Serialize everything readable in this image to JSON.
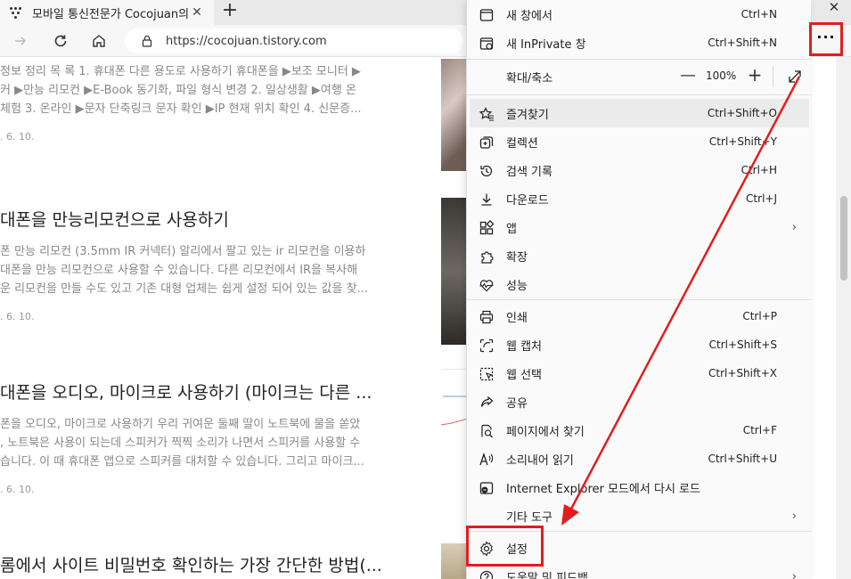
{
  "browser": {
    "tab_title": "모바일 통신전문가 Cocojuan의 :",
    "url": "https://cocojuan.tistory.com"
  },
  "articles": [
    {
      "title": "",
      "lines": [
        "정보 정리 목 록 1. 휴대폰 다른 용도로 사용하기 휴대폰을 ▶보조 모니터 ▶",
        "커 ▶만능 리모컨 ▶E-Book 동기화, 파일 형식 변경 2. 일상생활 ▶여행 온",
        " 체험 3. 온라인 ▶문자 단축링크 문자 확인 ▶IP 현재 위치 확인 4. 신문증..."
      ],
      "date": ". 6. 10."
    },
    {
      "title": "대폰을 만능리모컨으로 사용하기",
      "lines": [
        "폰 만능 리모컨 (3.5mm IR 커넥터) 알리에서 팔고 있는 ir 리모컨을 이용하",
        "대폰을 만능 리모컨으로 사용할 수 있습니다. 다른 리모컨에서 IR을 복사해",
        "운 리모컨을 만들 수도 있고 기존 대형 업체는 쉽게 설정 되어 있는 값을 찾..."
      ],
      "date": ". 6. 10."
    },
    {
      "title": "대폰을 오디오, 마이크로 사용하기 (마이크는 다른 ...",
      "lines": [
        "폰을 오디오, 마이크로 사용하기 우리 귀여운 둘째 딸이 노트북에 물을 쏟았",
        ", 노트북은 사용이 되는데 스피커가 찍찍 소리가 나면서 스피커를 사용할 수",
        "습니다. 이 때 휴대폰 앱으로 스피커를 대처할 수 있습니다. 그리고 마이크..."
      ],
      "date": ". 6. 10."
    },
    {
      "title": "롬에서 사이트 비밀번호 확인하는 가장 간단한 방법(...",
      "lines": [],
      "date": ""
    }
  ],
  "menu": {
    "items": [
      {
        "id": "new-window",
        "icon": "window-icon",
        "label": "새 창에서",
        "shortcut": "Ctrl+N"
      },
      {
        "id": "new-inprivate",
        "icon": "inprivate-icon",
        "label": "새 InPrivate 창",
        "shortcut": "Ctrl+Shift+N"
      },
      {
        "id": "zoom",
        "icon": "",
        "label": "확대/축소",
        "shortcut": ""
      },
      {
        "id": "favorites",
        "icon": "favorites-icon",
        "label": "즐겨찾기",
        "shortcut": "Ctrl+Shift+O"
      },
      {
        "id": "collections",
        "icon": "collections-icon",
        "label": "컬렉션",
        "shortcut": "Ctrl+Shift+Y"
      },
      {
        "id": "history",
        "icon": "history-icon",
        "label": "검색 기록",
        "shortcut": "Ctrl+H"
      },
      {
        "id": "downloads",
        "icon": "download-icon",
        "label": "다운로드",
        "shortcut": "Ctrl+J"
      },
      {
        "id": "apps",
        "icon": "apps-icon",
        "label": "앱",
        "shortcut": ""
      },
      {
        "id": "extensions",
        "icon": "extensions-icon",
        "label": "확장",
        "shortcut": ""
      },
      {
        "id": "performance",
        "icon": "performance-icon",
        "label": "성능",
        "shortcut": ""
      },
      {
        "id": "print",
        "icon": "print-icon",
        "label": "인쇄",
        "shortcut": "Ctrl+P"
      },
      {
        "id": "web-capture",
        "icon": "web-capture-icon",
        "label": "웹 캡처",
        "shortcut": "Ctrl+Shift+S"
      },
      {
        "id": "web-select",
        "icon": "web-select-icon",
        "label": "웹 선택",
        "shortcut": "Ctrl+Shift+X"
      },
      {
        "id": "share",
        "icon": "share-icon",
        "label": "공유",
        "shortcut": ""
      },
      {
        "id": "find",
        "icon": "find-icon",
        "label": "페이지에서 찾기",
        "shortcut": "Ctrl+F"
      },
      {
        "id": "read-aloud",
        "icon": "read-aloud-icon",
        "label": "소리내어 읽기",
        "shortcut": "Ctrl+Shift+U"
      },
      {
        "id": "ie-mode",
        "icon": "ie-icon",
        "label": "Internet Explorer 모드에서 다시 로드",
        "shortcut": ""
      },
      {
        "id": "more-tools",
        "icon": "",
        "label": "기타 도구",
        "shortcut": ""
      },
      {
        "id": "settings",
        "icon": "gear-icon",
        "label": "설정",
        "shortcut": ""
      },
      {
        "id": "help",
        "icon": "help-icon",
        "label": "도움말 및 피드백",
        "shortcut": ""
      }
    ],
    "zoom_value": "100%",
    "zoom_minus": "—",
    "zoom_plus": "+"
  },
  "annotation_color": "#e21d1d"
}
